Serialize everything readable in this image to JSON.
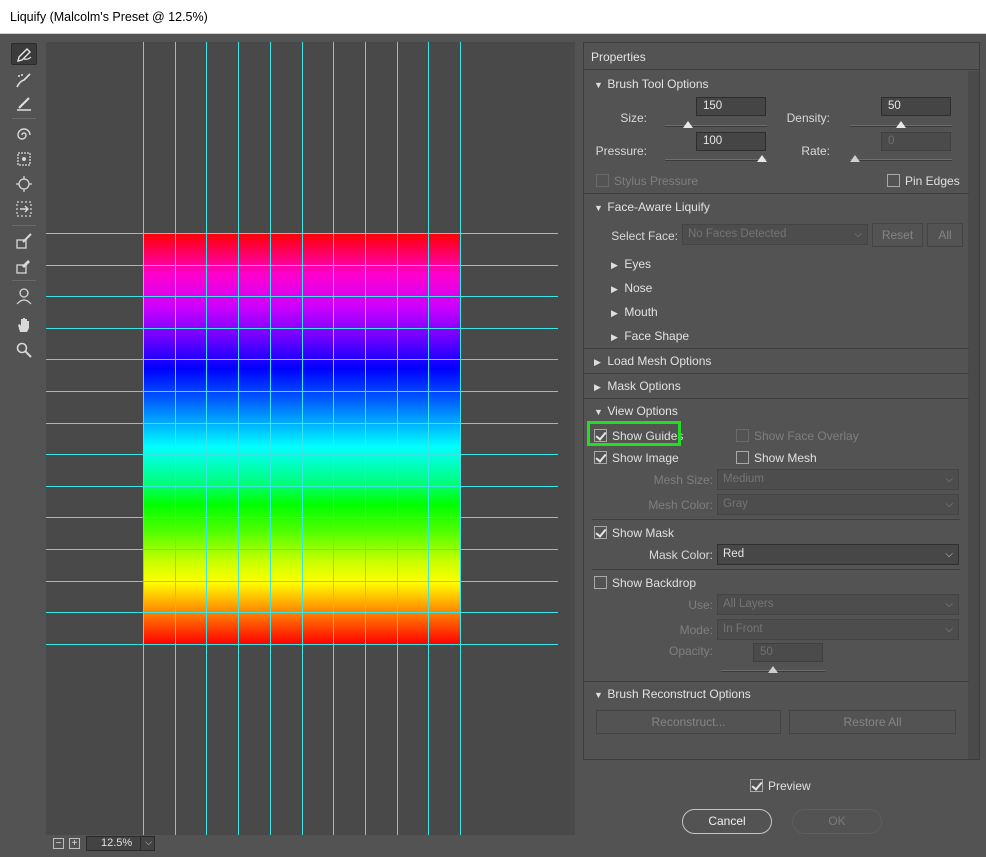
{
  "window": {
    "title": "Liquify (Malcolm's Preset @ 12.5%)"
  },
  "tools": [
    {
      "name": "forward-warp-tool",
      "icon": "warp-icon"
    },
    {
      "name": "reconstruct-tool",
      "icon": "reconstruct-brush-icon"
    },
    {
      "name": "smooth-tool",
      "icon": "smooth-brush-icon"
    },
    {
      "name": "twirl-clockwise-tool",
      "icon": "twirl-icon"
    },
    {
      "name": "pucker-tool",
      "icon": "pucker-icon"
    },
    {
      "name": "bloat-tool",
      "icon": "bloat-icon"
    },
    {
      "name": "push-left-tool",
      "icon": "push-left-icon"
    },
    {
      "name": "freeze-mask-tool",
      "icon": "freeze-mask-icon"
    },
    {
      "name": "thaw-mask-tool",
      "icon": "thaw-mask-icon"
    },
    {
      "name": "face-tool",
      "icon": "face-icon"
    },
    {
      "name": "hand-tool",
      "icon": "hand-icon"
    },
    {
      "name": "zoom-tool",
      "icon": "zoom-icon"
    }
  ],
  "zoom": {
    "minus": "−",
    "plus": "+",
    "value": "12.5%",
    "dropdown": "⌵"
  },
  "properties": {
    "title": "Properties",
    "brush_tool_options": {
      "header": "Brush Tool Options",
      "size_label": "Size:",
      "size_value": "150",
      "size_level": 0.2,
      "density_label": "Density:",
      "density_value": "50",
      "density_level": 0.5,
      "pressure_label": "Pressure:",
      "pressure_value": "100",
      "pressure_level": 1.0,
      "rate_label": "Rate:",
      "rate_value": "0",
      "rate_level": 0.0,
      "stylus_pressure": "Stylus Pressure",
      "pin_edges": "Pin Edges"
    },
    "face_aware": {
      "header": "Face-Aware Liquify",
      "select_face_label": "Select Face:",
      "select_face_value": "No Faces Detected",
      "reset": "Reset",
      "all": "All",
      "items": [
        "Eyes",
        "Nose",
        "Mouth",
        "Face Shape"
      ]
    },
    "load_mesh": {
      "header": "Load Mesh Options"
    },
    "mask_options": {
      "header": "Mask Options"
    },
    "view_options": {
      "header": "View Options",
      "show_guides": "Show Guides",
      "show_face_overlay": "Show Face Overlay",
      "show_image": "Show Image",
      "show_mesh": "Show Mesh",
      "mesh_size_label": "Mesh Size:",
      "mesh_size_value": "Medium",
      "mesh_color_label": "Mesh Color:",
      "mesh_color_value": "Gray",
      "show_mask": "Show Mask",
      "mask_color_label": "Mask Color:",
      "mask_color_value": "Red",
      "show_backdrop": "Show Backdrop",
      "use_label": "Use:",
      "use_value": "All Layers",
      "mode_label": "Mode:",
      "mode_value": "In Front",
      "opacity_label": "Opacity:",
      "opacity_value": "50",
      "opacity_level": 0.5
    },
    "brush_reconstruct": {
      "header": "Brush Reconstruct Options",
      "reconstruct": "Reconstruct...",
      "restore_all": "Restore All"
    }
  },
  "footer": {
    "preview": "Preview",
    "cancel": "Cancel",
    "ok": "OK"
  },
  "colors": {
    "guide": "#39e6e6",
    "highlight": "#22dd22",
    "panel_bg": "#535353"
  }
}
